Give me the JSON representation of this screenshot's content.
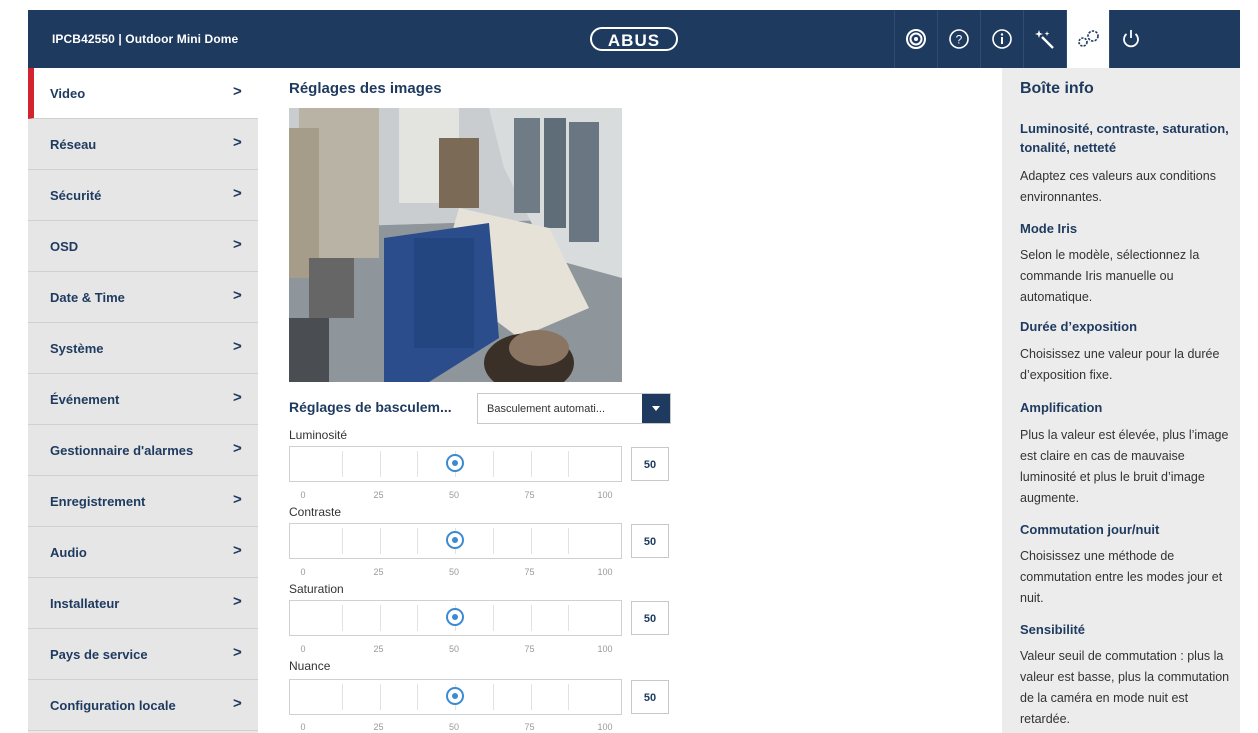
{
  "header": {
    "device_title": "IPCB42550 | Outdoor Mini Dome",
    "logo_text": "ABUS",
    "icons": [
      "live-view-icon",
      "help-icon",
      "info-icon",
      "wand-icon",
      "settings-gears-icon",
      "power-icon"
    ]
  },
  "sidebar": {
    "items": [
      {
        "label": "Video",
        "active": true
      },
      {
        "label": "Réseau"
      },
      {
        "label": "Sécurité"
      },
      {
        "label": "OSD"
      },
      {
        "label": "Date & Time"
      },
      {
        "label": "Système"
      },
      {
        "label": "Événement"
      },
      {
        "label": "Gestionnaire d'alarmes"
      },
      {
        "label": "Enregistrement"
      },
      {
        "label": "Audio"
      },
      {
        "label": "Installateur"
      },
      {
        "label": "Pays de service"
      },
      {
        "label": "Configuration locale"
      }
    ],
    "chevron": ">"
  },
  "main": {
    "title": "Réglages des images",
    "switch_label": "Réglages de basculem...",
    "switch_value": "Basculement automati...",
    "tick_labels": [
      "0",
      "25",
      "50",
      "75",
      "100"
    ],
    "sliders": [
      {
        "label": "Luminosité",
        "value": "50",
        "min": 0,
        "max": 100
      },
      {
        "label": "Contraste",
        "value": "50",
        "min": 0,
        "max": 100
      },
      {
        "label": "Saturation",
        "value": "50",
        "min": 0,
        "max": 100
      },
      {
        "label": "Nuance",
        "value": "50",
        "min": 0,
        "max": 100
      }
    ]
  },
  "info": {
    "title": "Boîte info",
    "sections": [
      {
        "heading": "Luminosité, contraste, saturation, tonalité, netteté",
        "text": "Adaptez ces valeurs aux conditions environnantes."
      },
      {
        "heading": "Mode Iris",
        "text": "Selon le modèle, sélectionnez la commande Iris manuelle ou automatique."
      },
      {
        "heading": "Durée d’exposition",
        "text": "Choisissez une valeur pour la durée d’exposition fixe."
      },
      {
        "heading": "Amplification",
        "text": "Plus la valeur est élevée, plus l’image est claire en cas de mauvaise luminosité et plus le bruit d’image augmente."
      },
      {
        "heading": "Commutation jour/nuit",
        "text": "Choisissez une méthode de commutation entre les modes jour et nuit."
      },
      {
        "heading": "Sensibilité",
        "text": "Valeur seuil de commutation : plus la valeur est basse, plus la commutation de la caméra en mode nuit est retardée."
      }
    ]
  },
  "colors": {
    "header_bg": "#1e3a5f",
    "accent_red": "#d1242f",
    "slider_blue": "#3b8ad2"
  }
}
